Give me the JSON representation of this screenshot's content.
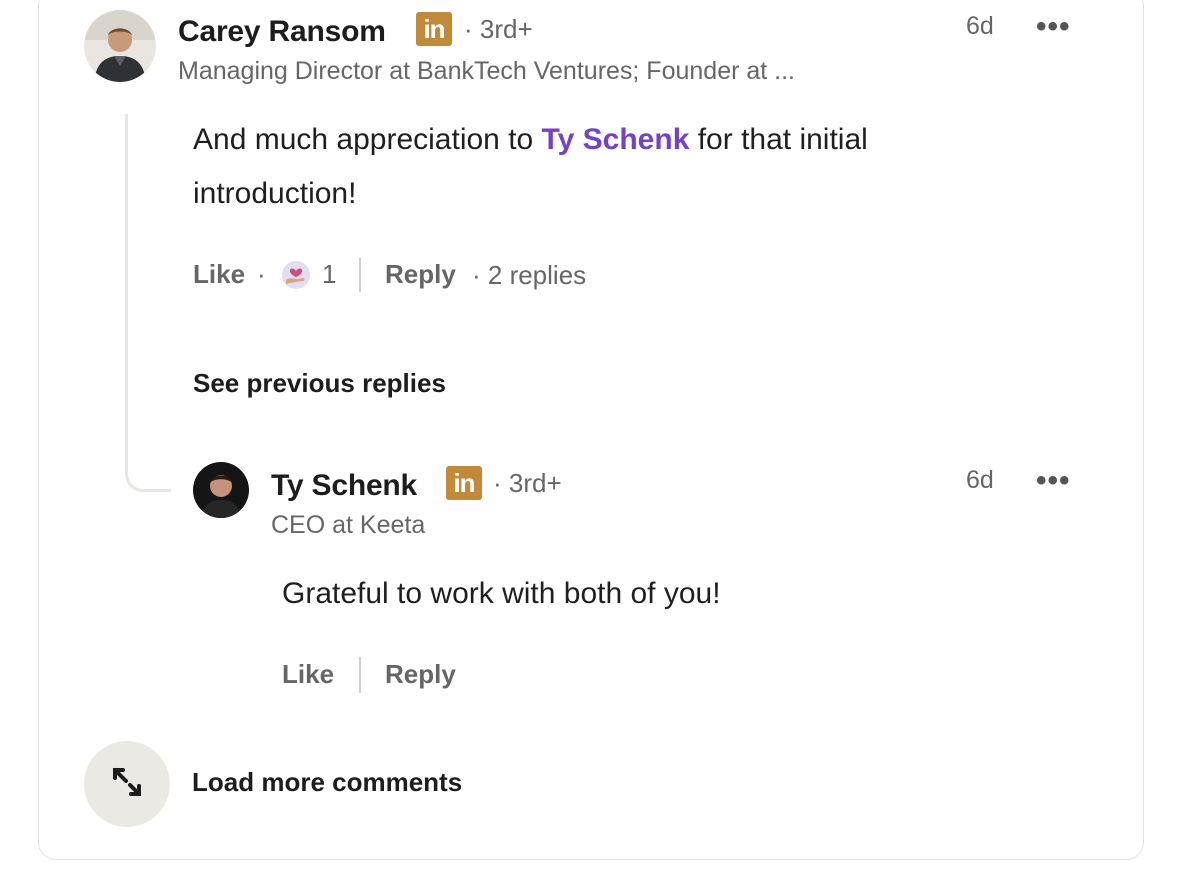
{
  "comments": [
    {
      "author": "Carey Ransom",
      "linkedin_badge": "in",
      "degree": "· 3rd+",
      "headline": "Managing Director at BankTech Ventures; Founder at ...",
      "time": "6d",
      "more": "•••",
      "text_before": "And much appreciation to ",
      "mention": "Ty Schenk",
      "text_after_line1": " for that initial",
      "text_line2": "introduction!",
      "like_label": "Like",
      "dot1": "·",
      "reaction_count": "1",
      "reply_label": "Reply",
      "replies_text": "· 2 replies"
    }
  ],
  "see_previous": "See previous replies",
  "reply": {
    "author": "Ty Schenk",
    "linkedin_badge": "in",
    "degree": "· 3rd+",
    "headline": "CEO at Keeta",
    "time": "6d",
    "more": "•••",
    "text": "Grateful to work with both of you!",
    "like_label": "Like",
    "reply_label": "Reply"
  },
  "load_more": "Load more comments",
  "colors": {
    "mention": "#7442c8",
    "badge": "#c08a3a",
    "muted": "#666666"
  },
  "icons": {
    "reaction": "support-heart-hand-icon",
    "load_more": "expand-arrows-icon"
  }
}
